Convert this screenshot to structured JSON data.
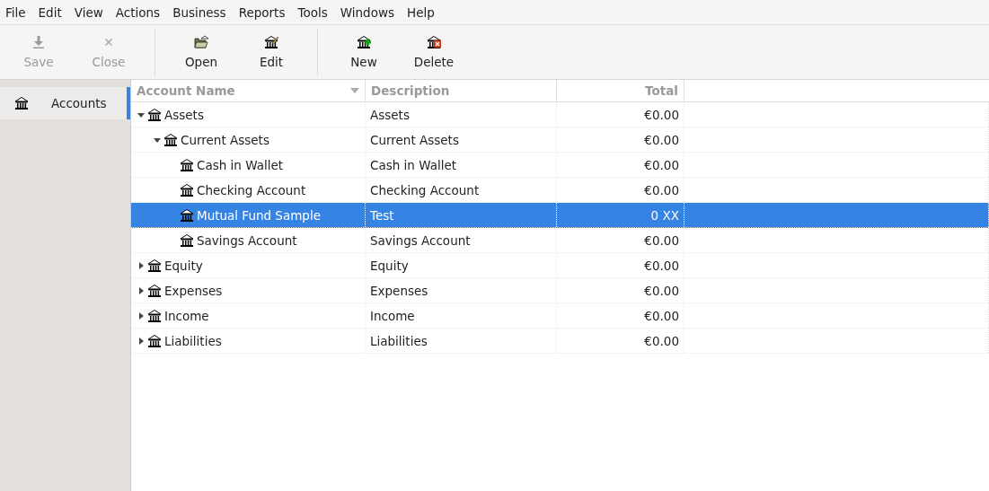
{
  "menu": [
    "File",
    "Edit",
    "View",
    "Actions",
    "Business",
    "Reports",
    "Tools",
    "Windows",
    "Help"
  ],
  "toolbar": [
    {
      "label": "Save",
      "kind": "save",
      "disabled": true
    },
    {
      "label": "Close",
      "kind": "close",
      "disabled": true
    },
    {
      "label": "Open",
      "kind": "open",
      "disabled": false,
      "group_start": true
    },
    {
      "label": "Edit",
      "kind": "edit",
      "disabled": false
    },
    {
      "label": "New",
      "kind": "new",
      "disabled": false,
      "group_start": true
    },
    {
      "label": "Delete",
      "kind": "delete",
      "disabled": false
    }
  ],
  "sidebar": {
    "items": [
      {
        "label": "Accounts",
        "selected": true
      }
    ]
  },
  "table": {
    "columns": [
      {
        "label": "Account Name",
        "sorted": true
      },
      {
        "label": "Description",
        "sorted": false
      },
      {
        "label": "Total",
        "sorted": false
      }
    ],
    "rows": [
      {
        "name": "Assets",
        "description": "Assets",
        "total": "€0.00",
        "expanded": true,
        "selected": false,
        "children": [
          {
            "name": "Current Assets",
            "description": "Current Assets",
            "total": "€0.00",
            "expanded": true,
            "selected": false,
            "children": [
              {
                "name": "Cash in Wallet",
                "description": "Cash in Wallet",
                "total": "€0.00",
                "selected": false
              },
              {
                "name": "Checking Account",
                "description": "Checking Account",
                "total": "€0.00",
                "selected": false
              },
              {
                "name": "Mutual Fund Sample",
                "description": "Test",
                "total": "0 XX",
                "selected": true
              },
              {
                "name": "Savings Account",
                "description": "Savings Account",
                "total": "€0.00",
                "selected": false
              }
            ]
          }
        ]
      },
      {
        "name": "Equity",
        "description": "Equity",
        "total": "€0.00",
        "expanded": false,
        "selected": false
      },
      {
        "name": "Expenses",
        "description": "Expenses",
        "total": "€0.00",
        "expanded": false,
        "selected": false
      },
      {
        "name": "Income",
        "description": "Income",
        "total": "€0.00",
        "expanded": false,
        "selected": false
      },
      {
        "name": "Liabilities",
        "description": "Liabilities",
        "total": "€0.00",
        "expanded": false,
        "selected": false
      }
    ]
  }
}
